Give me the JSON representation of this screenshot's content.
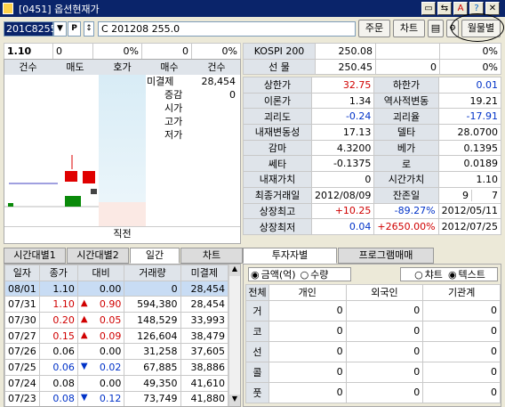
{
  "window": {
    "title": "[0451] 옵션현재가"
  },
  "toolbar": {
    "code": "201C8255",
    "option_name": "C 201208 255.0",
    "order": "주문",
    "chart": "차트",
    "monthly": "월물별"
  },
  "summary": {
    "price": "1.10",
    "change": "0",
    "pct": "0%",
    "v1": "0",
    "v2": "0%"
  },
  "orderbook": {
    "headers": [
      "건수",
      "매도",
      "호가",
      "매수",
      "건수"
    ],
    "labels": [
      "미결제",
      "증감",
      "시가",
      "고가",
      "저가"
    ],
    "values": [
      "28,454",
      "0",
      "",
      "",
      ""
    ],
    "footer": "직전"
  },
  "index_table": [
    {
      "label": "KOSPI 200",
      "v1": "250.08",
      "v2": "",
      "v3": "0%"
    },
    {
      "label": "선  물",
      "v1": "250.45",
      "v2": "0",
      "v3": "0%"
    }
  ],
  "details": [
    {
      "l1": "상한가",
      "v1": "32.75",
      "c1": "red",
      "l2": "하한가",
      "v2": "0.01",
      "c2": "blue"
    },
    {
      "l1": "이론가",
      "v1": "1.34",
      "c1": "",
      "l2": "역사적변동",
      "v2": "19.21",
      "c2": ""
    },
    {
      "l1": "괴리도",
      "v1": "-0.24",
      "c1": "blue",
      "l2": "괴리율",
      "v2": "-17.91",
      "c2": "blue"
    },
    {
      "l1": "내재변동성",
      "v1": "17.13",
      "c1": "",
      "l2": "델타",
      "v2": "28.0700",
      "c2": ""
    },
    {
      "l1": "감마",
      "v1": "4.3200",
      "c1": "",
      "l2": "베가",
      "v2": "0.1395",
      "c2": ""
    },
    {
      "l1": "쎄타",
      "v1": "-0.1375",
      "c1": "",
      "l2": "로",
      "v2": "0.0189",
      "c2": ""
    },
    {
      "l1": "내재가치",
      "v1": "0",
      "c1": "",
      "l2": "시간가치",
      "v2": "1.10",
      "c2": ""
    }
  ],
  "expiry": {
    "l1": "최종거래일",
    "v1": "2012/08/09",
    "l2": "잔존일",
    "v2": "9",
    "v3": "7"
  },
  "highs": [
    {
      "label": "상장최고",
      "v1": "+10.25",
      "c1": "red",
      "v2": "-89.27%",
      "c2": "blue",
      "date": "2012/05/11"
    },
    {
      "label": "상장최저",
      "v1": "0.04",
      "c1": "blue",
      "v2": "+2650.00%",
      "c2": "red",
      "date": "2012/07/25"
    }
  ],
  "left_tabs": [
    "시간대별1",
    "시간대별2",
    "일간",
    "차트"
  ],
  "daily": {
    "headers": [
      "일자",
      "종가",
      "대비",
      "거래량",
      "미결제"
    ],
    "rows": [
      {
        "date": "08/01",
        "close": "1.10",
        "diff": "0.00",
        "dir": "",
        "color": "",
        "vol": "0",
        "oi": "28,454"
      },
      {
        "date": "07/31",
        "close": "1.10",
        "diff": "0.90",
        "dir": "up",
        "color": "red",
        "vol": "594,380",
        "oi": "28,454"
      },
      {
        "date": "07/30",
        "close": "0.20",
        "diff": "0.05",
        "dir": "up",
        "color": "red",
        "vol": "148,529",
        "oi": "33,993"
      },
      {
        "date": "07/27",
        "close": "0.15",
        "diff": "0.09",
        "dir": "up",
        "color": "red",
        "vol": "126,604",
        "oi": "38,479"
      },
      {
        "date": "07/26",
        "close": "0.06",
        "diff": "0.00",
        "dir": "",
        "color": "",
        "vol": "31,258",
        "oi": "37,605"
      },
      {
        "date": "07/25",
        "close": "0.06",
        "diff": "0.02",
        "dir": "down",
        "color": "blue",
        "vol": "67,885",
        "oi": "38,886"
      },
      {
        "date": "07/24",
        "close": "0.08",
        "diff": "0.00",
        "dir": "",
        "color": "",
        "vol": "49,350",
        "oi": "41,610"
      },
      {
        "date": "07/23",
        "close": "0.08",
        "diff": "0.12",
        "dir": "down",
        "color": "blue",
        "vol": "73,749",
        "oi": "41,880"
      }
    ]
  },
  "right_tabs": [
    "투자자별",
    "프로그램매매"
  ],
  "radio": {
    "amount": "금액(억)",
    "qty": "수량",
    "chart": "챠트",
    "text": "텍스트"
  },
  "investor": {
    "headers": [
      "전체",
      "개인",
      "외국인",
      "기관계"
    ],
    "rows": [
      {
        "label": "거",
        "v": [
          "0",
          "0",
          "0"
        ]
      },
      {
        "label": "코",
        "v": [
          "0",
          "0",
          "0"
        ]
      },
      {
        "label": "선",
        "v": [
          "0",
          "0",
          "0"
        ]
      },
      {
        "label": "콜",
        "v": [
          "0",
          "0",
          "0"
        ]
      },
      {
        "label": "풋",
        "v": [
          "0",
          "0",
          "0"
        ]
      }
    ]
  }
}
